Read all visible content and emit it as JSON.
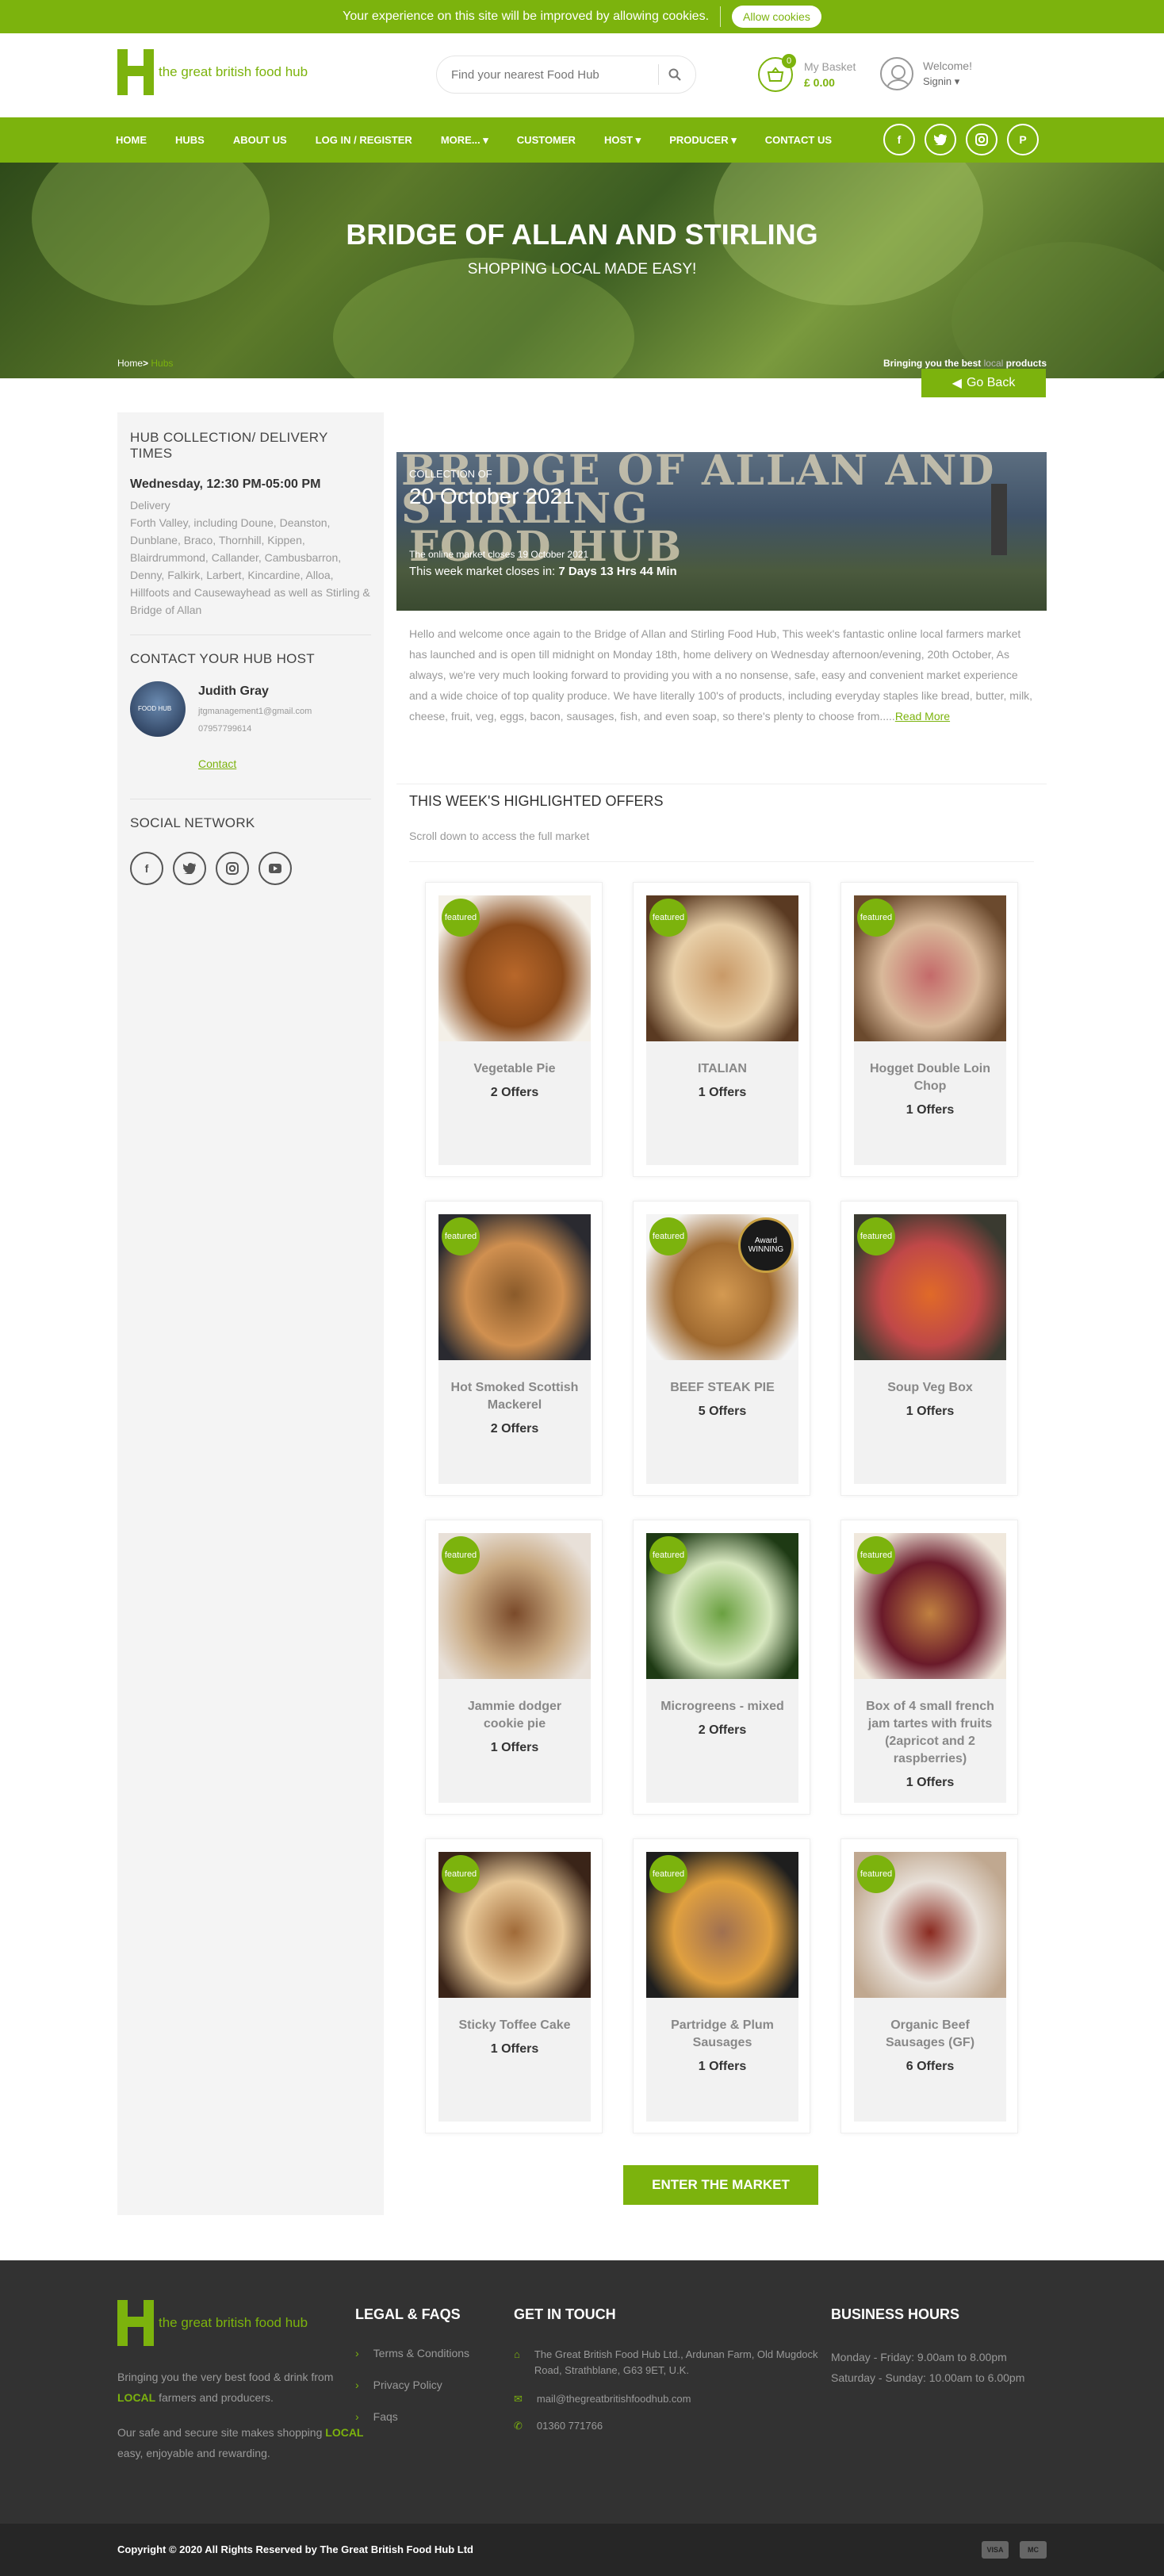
{
  "cookie": {
    "message": "Your experience on this site will be improved by allowing cookies.",
    "button": "Allow cookies"
  },
  "header": {
    "logo_text": "the great british food hub",
    "search_placeholder": "Find your nearest Food Hub",
    "basket_count": "0",
    "basket_label": "My Basket",
    "basket_total": "£ 0.00",
    "welcome": "Welcome!",
    "signin": "Signin ▾"
  },
  "nav": {
    "items": [
      "HOME",
      "HUBS",
      "ABOUT US",
      "LOG IN / REGISTER",
      "MORE... ▾",
      "CUSTOMER",
      "HOST ▾",
      "PRODUCER ▾",
      "CONTACT US"
    ]
  },
  "social_icons": [
    "facebook-icon",
    "twitter-icon",
    "instagram-icon",
    "pinterest-icon"
  ],
  "hero": {
    "title": "BRIDGE OF ALLAN AND STIRLING",
    "subtitle": "SHOPPING LOCAL MADE EASY!",
    "crumb_home": "Home",
    "crumb_sep": ">",
    "crumb_current": "Hubs",
    "bringing_pre": "Bringing you the best",
    "bringing_mid": "local",
    "bringing_post": "products"
  },
  "go_back": "Go Back",
  "sidebar": {
    "times_title": "HUB COLLECTION/ DELIVERY TIMES",
    "day": "Wednesday, 12:30 PM-05:00 PM",
    "delivery_label": "Delivery",
    "delivery_text": "Forth Valley, including Doune, Deanston, Dunblane, Braco, Thornhill, Kippen, Blairdrummond, Callander, Cambusbarron, Denny, Falkirk, Larbert, Kincardine, Alloa, Hillfoots and Causewayhead as well as Stirling & Bridge of Allan",
    "host_title": "CONTACT YOUR HUB HOST",
    "host_photo_text": "FOOD HUB",
    "host_name": "Judith Gray",
    "host_email": "jtgmanagement1@gmail.com",
    "host_phone": "07957799614",
    "host_contact": "Contact",
    "social_title": "SOCIAL NETWORK"
  },
  "banner": {
    "bg_text_1": "BRIDGE OF ALLAN AND STIRLING",
    "bg_text_2": "FOOD HUB",
    "collection_label": "COLLECTION OF",
    "date": "20 October 2021",
    "closes_note": "The online market closes 19 October 2021",
    "countdown_pre": "This week market closes in:",
    "countdown": "7 Days 13 Hrs 44 Min"
  },
  "intro": {
    "text": "Hello and welcome once again to the Bridge of Allan and Stirling Food Hub, This week's fantastic online local farmers market has launched and is open till midnight on Monday 18th, home delivery on Wednesday afternoon/evening, 20th October, As always, we're very much looking forward to providing you with a no nonsense, safe, easy and convenient market experience and a wide choice of top quality produce. We have literally 100's of products, including everyday staples like bread, butter, milk, cheese, fruit, veg, eggs, bacon, sausages, fish, and even soap, so there's plenty to choose from.....",
    "read_more": "Read More"
  },
  "offers": {
    "title": "THIS WEEK'S HIGHLIGHTED OFFERS",
    "subtitle": "Scroll down to access the full market",
    "featured_label": "featured",
    "award_text": "Award WINNING",
    "items": [
      {
        "name": "Vegetable Pie",
        "offers": "2 Offers",
        "colors": [
          "#f4f0e8",
          "#b8672a",
          "#8a4a1a"
        ]
      },
      {
        "name": "ITALIAN",
        "offers": "1 Offers",
        "colors": [
          "#5a3a22",
          "#c99a68",
          "#e8cfa8"
        ]
      },
      {
        "name": "Hogget Double Loin Chop",
        "offers": "1 Offers",
        "colors": [
          "#6b4a2e",
          "#c46a6a",
          "#d9b99a"
        ]
      },
      {
        "name": "Hot Smoked Scottish Mackerel",
        "offers": "2 Offers",
        "colors": [
          "#2a2a30",
          "#8a5a2a",
          "#d09050"
        ]
      },
      {
        "name": "BEEF STEAK PIE",
        "offers": "5 Offers",
        "colors": [
          "#f4f4f4",
          "#d49a52",
          "#a06a30"
        ]
      },
      {
        "name": "Soup Veg Box",
        "offers": "1 Offers",
        "colors": [
          "#3a3a30",
          "#e06a28",
          "#c04848"
        ]
      },
      {
        "name": "Jammie dodger cookie pie",
        "offers": "1 Offers",
        "colors": [
          "#e8e0d8",
          "#7a4a2a",
          "#c8a880"
        ]
      },
      {
        "name": "Microgreens - mixed",
        "offers": "2 Offers",
        "colors": [
          "#1e3a14",
          "#6aa040",
          "#d8e8c0"
        ]
      },
      {
        "name": "Box of 4 small french jam tartes with fruits (2apricot and 2 raspberries)",
        "offers": "1 Offers",
        "colors": [
          "#f0e8dc",
          "#c08040",
          "#6a1a2a"
        ]
      },
      {
        "name": "Sticky Toffee Cake",
        "offers": "1 Offers",
        "colors": [
          "#3a2418",
          "#a06a38",
          "#e8c898"
        ]
      },
      {
        "name": "Partridge & Plum Sausages",
        "offers": "1 Offers",
        "colors": [
          "#1e1e1e",
          "#a07050",
          "#e0a040"
        ]
      },
      {
        "name": "Organic Beef Sausages (GF)",
        "offers": "6 Offers",
        "colors": [
          "#c0a890",
          "#8a2a20",
          "#e8e0d8"
        ]
      }
    ]
  },
  "enter_market": "ENTER THE MARKET",
  "footer": {
    "logo_text": "the great british food hub",
    "about_1a": "Bringing you the very best food & drink from ",
    "about_1b": "LOCAL",
    "about_1c": " farmers and producers.",
    "about_2a": "Our safe and secure site makes shopping ",
    "about_2b": "LOCAL",
    "about_2c": " easy, enjoyable and rewarding.",
    "legal_title": "LEGAL & FAQS",
    "legal_items": [
      "Terms & Conditions",
      "Privacy Policy",
      "Faqs"
    ],
    "touch_title": "GET IN TOUCH",
    "address": "The Great British Food Hub Ltd., Ardunan Farm, Old Mugdock Road, Strathblane, G63 9ET, U.K.",
    "email": "mail@thegreatbritishfoodhub.com",
    "phone": "01360 771766",
    "hours_title": "BUSINESS HOURS",
    "hours_1": "Monday - Friday: 9.00am to 8.00pm",
    "hours_2": "Saturday - Sunday: 10.00am to 6.00pm"
  },
  "copyright": "Copyright © 2020 All Rights Reserved by The Great British Food Hub Ltd",
  "payment_cards": [
    "VISA",
    "MC"
  ],
  "colors": {
    "brand_green": "#7cb30d",
    "footer_bg": "#323232",
    "bottom_bg": "#262626"
  }
}
